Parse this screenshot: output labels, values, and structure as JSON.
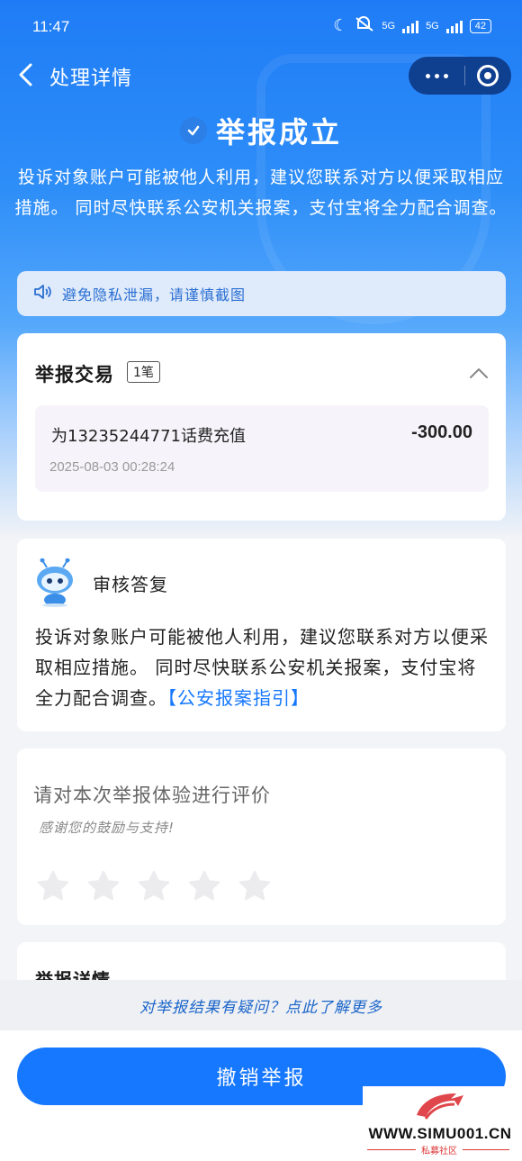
{
  "status_bar": {
    "time": "11:47",
    "net1": "5G",
    "net2": "5G",
    "battery": "42"
  },
  "nav": {
    "title": "处理详情"
  },
  "status": {
    "title": "举报成立",
    "description": "投诉对象账户可能被他人利用，建议您联系对方以便采取相应措施。 同时尽快联系公安机关报案，支付宝将全力配合调查。"
  },
  "notice": {
    "text": "避免隐私泄漏，请谨慎截图"
  },
  "transactions": {
    "title": "举报交易",
    "count": "1笔",
    "items": [
      {
        "name": "为13235244771话费充值",
        "amount": "-300.00",
        "time": "2025-08-03  00:28:24"
      }
    ]
  },
  "review": {
    "title": "审核答复",
    "body": "投诉对象账户可能被他人利用，建议您联系对方以便采取相应措施。 同时尽快联系公安机关报案，支付宝将全力配合调查。",
    "link": "【公安报案指引】"
  },
  "rating": {
    "title": "请对本次举报体验进行评价",
    "subtitle": "感谢您的鼓励与支持!",
    "stars": 0,
    "max_stars": 5
  },
  "detail": {
    "title": "举报详情"
  },
  "footer": {
    "question_link": "对举报结果有疑问？点此了解更多",
    "revoke_button": "撤销举报"
  },
  "watermark": {
    "site": "WWW.SIMU001.CN",
    "community": "私募社区"
  },
  "colors": {
    "primary": "#1677ff",
    "hero_top": "#1f7cf6",
    "link": "#1a64c8",
    "watermark_red": "#d33"
  }
}
